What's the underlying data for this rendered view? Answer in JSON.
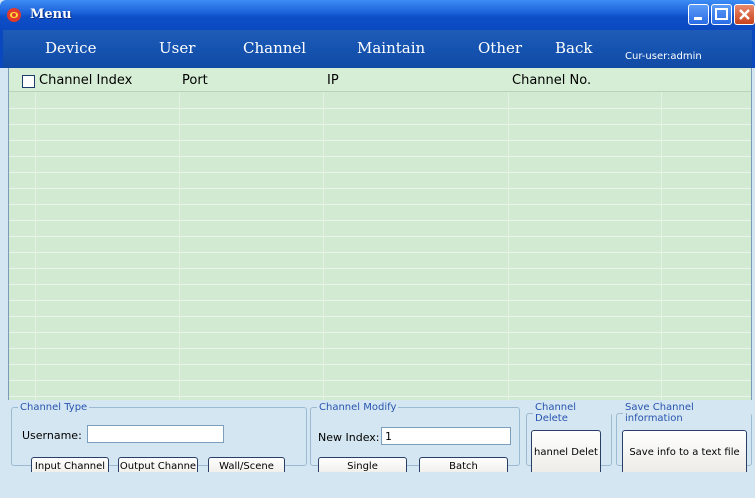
{
  "window": {
    "title": "Menu"
  },
  "menu": {
    "items": [
      "Device",
      "User",
      "Channel",
      "Maintain",
      "Other",
      "Back"
    ],
    "current_user": "Cur-user:admin"
  },
  "table": {
    "columns": [
      "Channel Index",
      "Port",
      "IP",
      "Channel No."
    ],
    "rows": []
  },
  "channel_type": {
    "legend": "Channel Type",
    "username_label": "Username:",
    "username_value": "",
    "input_button": "Input Channel",
    "output_button": "Output Channe",
    "wall_button": "Wall/Scene"
  },
  "channel_modify": {
    "legend": "Channel Modify",
    "new_index_label": "New Index:",
    "new_index_value": "1",
    "single_button": "Single",
    "batch_button": "Batch"
  },
  "channel_delete": {
    "legend": "Channel Delete",
    "delete_button": "hannel Delet"
  },
  "save_info": {
    "legend": "Save Channel information",
    "save_button": "Save info to a text file"
  },
  "colors": {
    "titlebar": "#1a5fd8",
    "menubar": "#1553b0",
    "grid_bg": "#d1ead1",
    "panel_bg": "#d4e6f1",
    "legend_text": "#2854b0"
  }
}
